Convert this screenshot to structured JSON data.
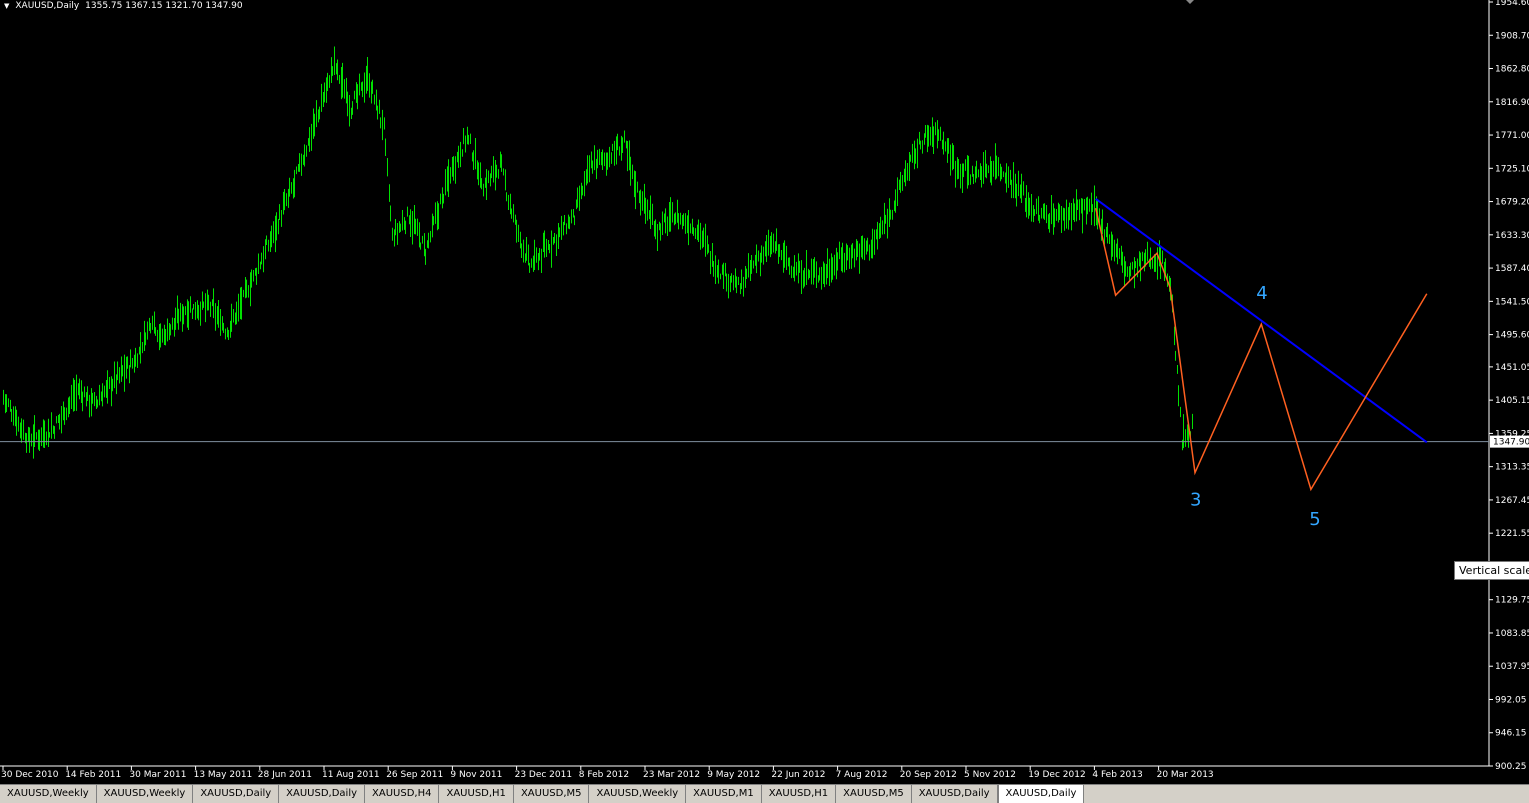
{
  "window": {
    "symbol": "XAUUSD,Daily",
    "ohlc": "1355.75 1367.15 1321.70 1347.90",
    "tooltip": "Vertical scale"
  },
  "colors": {
    "background": "#000000",
    "bars": "#00e000",
    "trendline": "#0000ff",
    "projection": "#ff6020",
    "price_line": "#8090a0",
    "wave_label": "#33a6ff",
    "axis": "#ffffff"
  },
  "chart_data": {
    "type": "ohlc-bar",
    "x_ticks": [
      "30 Dec 2010",
      "14 Feb 2011",
      "30 Mar 2011",
      "13 May 2011",
      "28 Jun 2011",
      "11 Aug 2011",
      "26 Sep 2011",
      "9 Nov 2011",
      "23 Dec 2011",
      "8 Feb 2012",
      "23 Mar 2012",
      "9 May 2012",
      "22 Jun 2012",
      "7 Aug 2012",
      "20 Sep 2012",
      "5 Nov 2012",
      "19 Dec 2012",
      "4 Feb 2013",
      "20 Mar 2013"
    ],
    "y_ticks": [
      1954.6,
      1908.7,
      1862.8,
      1816.9,
      1771.0,
      1725.1,
      1679.2,
      1633.3,
      1587.4,
      1541.5,
      1495.6,
      1451.05,
      1405.15,
      1359.25,
      1313.35,
      1267.45,
      1221.55,
      1175.65,
      1129.75,
      1083.85,
      1037.95,
      992.05,
      946.15,
      900.25
    ],
    "ylim": [
      900.25,
      1954.6
    ],
    "current_price": "1347.90",
    "price_path": [
      {
        "d": 0,
        "p": 1410
      },
      {
        "d": 15,
        "p": 1350
      },
      {
        "d": 30,
        "p": 1365
      },
      {
        "d": 45,
        "p": 1420
      },
      {
        "d": 55,
        "p": 1400
      },
      {
        "d": 70,
        "p": 1440
      },
      {
        "d": 80,
        "p": 1460
      },
      {
        "d": 90,
        "p": 1520
      },
      {
        "d": 95,
        "p": 1490
      },
      {
        "d": 110,
        "p": 1530
      },
      {
        "d": 125,
        "p": 1535
      },
      {
        "d": 135,
        "p": 1500
      },
      {
        "d": 145,
        "p": 1545
      },
      {
        "d": 160,
        "p": 1620
      },
      {
        "d": 175,
        "p": 1700
      },
      {
        "d": 190,
        "p": 1800
      },
      {
        "d": 200,
        "p": 1870
      },
      {
        "d": 210,
        "p": 1810
      },
      {
        "d": 220,
        "p": 1850
      },
      {
        "d": 230,
        "p": 1780
      },
      {
        "d": 235,
        "p": 1630
      },
      {
        "d": 245,
        "p": 1660
      },
      {
        "d": 255,
        "p": 1610
      },
      {
        "d": 270,
        "p": 1720
      },
      {
        "d": 280,
        "p": 1770
      },
      {
        "d": 290,
        "p": 1700
      },
      {
        "d": 300,
        "p": 1730
      },
      {
        "d": 310,
        "p": 1640
      },
      {
        "d": 318,
        "p": 1590
      },
      {
        "d": 330,
        "p": 1620
      },
      {
        "d": 345,
        "p": 1660
      },
      {
        "d": 355,
        "p": 1730
      },
      {
        "d": 365,
        "p": 1740
      },
      {
        "d": 375,
        "p": 1760
      },
      {
        "d": 382,
        "p": 1700
      },
      {
        "d": 395,
        "p": 1640
      },
      {
        "d": 405,
        "p": 1660
      },
      {
        "d": 420,
        "p": 1640
      },
      {
        "d": 430,
        "p": 1590
      },
      {
        "d": 445,
        "p": 1560
      },
      {
        "d": 455,
        "p": 1600
      },
      {
        "d": 465,
        "p": 1620
      },
      {
        "d": 480,
        "p": 1580
      },
      {
        "d": 495,
        "p": 1580
      },
      {
        "d": 505,
        "p": 1600
      },
      {
        "d": 515,
        "p": 1610
      },
      {
        "d": 525,
        "p": 1620
      },
      {
        "d": 535,
        "p": 1660
      },
      {
        "d": 545,
        "p": 1720
      },
      {
        "d": 555,
        "p": 1765
      },
      {
        "d": 565,
        "p": 1775
      },
      {
        "d": 575,
        "p": 1730
      },
      {
        "d": 585,
        "p": 1715
      },
      {
        "d": 600,
        "p": 1730
      },
      {
        "d": 612,
        "p": 1700
      },
      {
        "d": 625,
        "p": 1660
      },
      {
        "d": 640,
        "p": 1660
      },
      {
        "d": 650,
        "p": 1670
      },
      {
        "d": 660,
        "p": 1665
      },
      {
        "d": 670,
        "p": 1620
      },
      {
        "d": 680,
        "p": 1580
      },
      {
        "d": 690,
        "p": 1600
      },
      {
        "d": 700,
        "p": 1600
      },
      {
        "d": 705,
        "p": 1560
      },
      {
        "d": 712,
        "p": 1350
      },
      {
        "d": 718,
        "p": 1370
      }
    ],
    "trendline": [
      {
        "d": 660,
        "p": 1683
      },
      {
        "d": 860,
        "p": 1347
      }
    ],
    "projection": [
      {
        "d": 660,
        "p": 1670
      },
      {
        "d": 672,
        "p": 1550
      },
      {
        "d": 697,
        "p": 1608
      },
      {
        "d": 705,
        "p": 1560
      },
      {
        "d": 720,
        "p": 1305
      },
      {
        "d": 760,
        "p": 1510
      },
      {
        "d": 790,
        "p": 1282
      },
      {
        "d": 860,
        "p": 1552
      }
    ],
    "wave_labels": [
      {
        "text": "3",
        "d": 720,
        "p": 1260
      },
      {
        "text": "4",
        "d": 760,
        "p": 1545
      },
      {
        "text": "5",
        "d": 792,
        "p": 1233
      }
    ]
  },
  "tabs": [
    {
      "label": "XAUUSD,Weekly",
      "active": false
    },
    {
      "label": "XAUUSD,Weekly",
      "active": false
    },
    {
      "label": "XAUUSD,Daily",
      "active": false
    },
    {
      "label": "XAUUSD,Daily",
      "active": false
    },
    {
      "label": "XAUUSD,H4",
      "active": false
    },
    {
      "label": "XAUUSD,H1",
      "active": false
    },
    {
      "label": "XAUUSD,M5",
      "active": false
    },
    {
      "label": "XAUUSD,Weekly",
      "active": false
    },
    {
      "label": "XAUUSD,M1",
      "active": false
    },
    {
      "label": "XAUUSD,H1",
      "active": false
    },
    {
      "label": "XAUUSD,M5",
      "active": false
    },
    {
      "label": "XAUUSD,Daily",
      "active": false
    },
    {
      "label": "XAUUSD,Daily",
      "active": true
    }
  ]
}
